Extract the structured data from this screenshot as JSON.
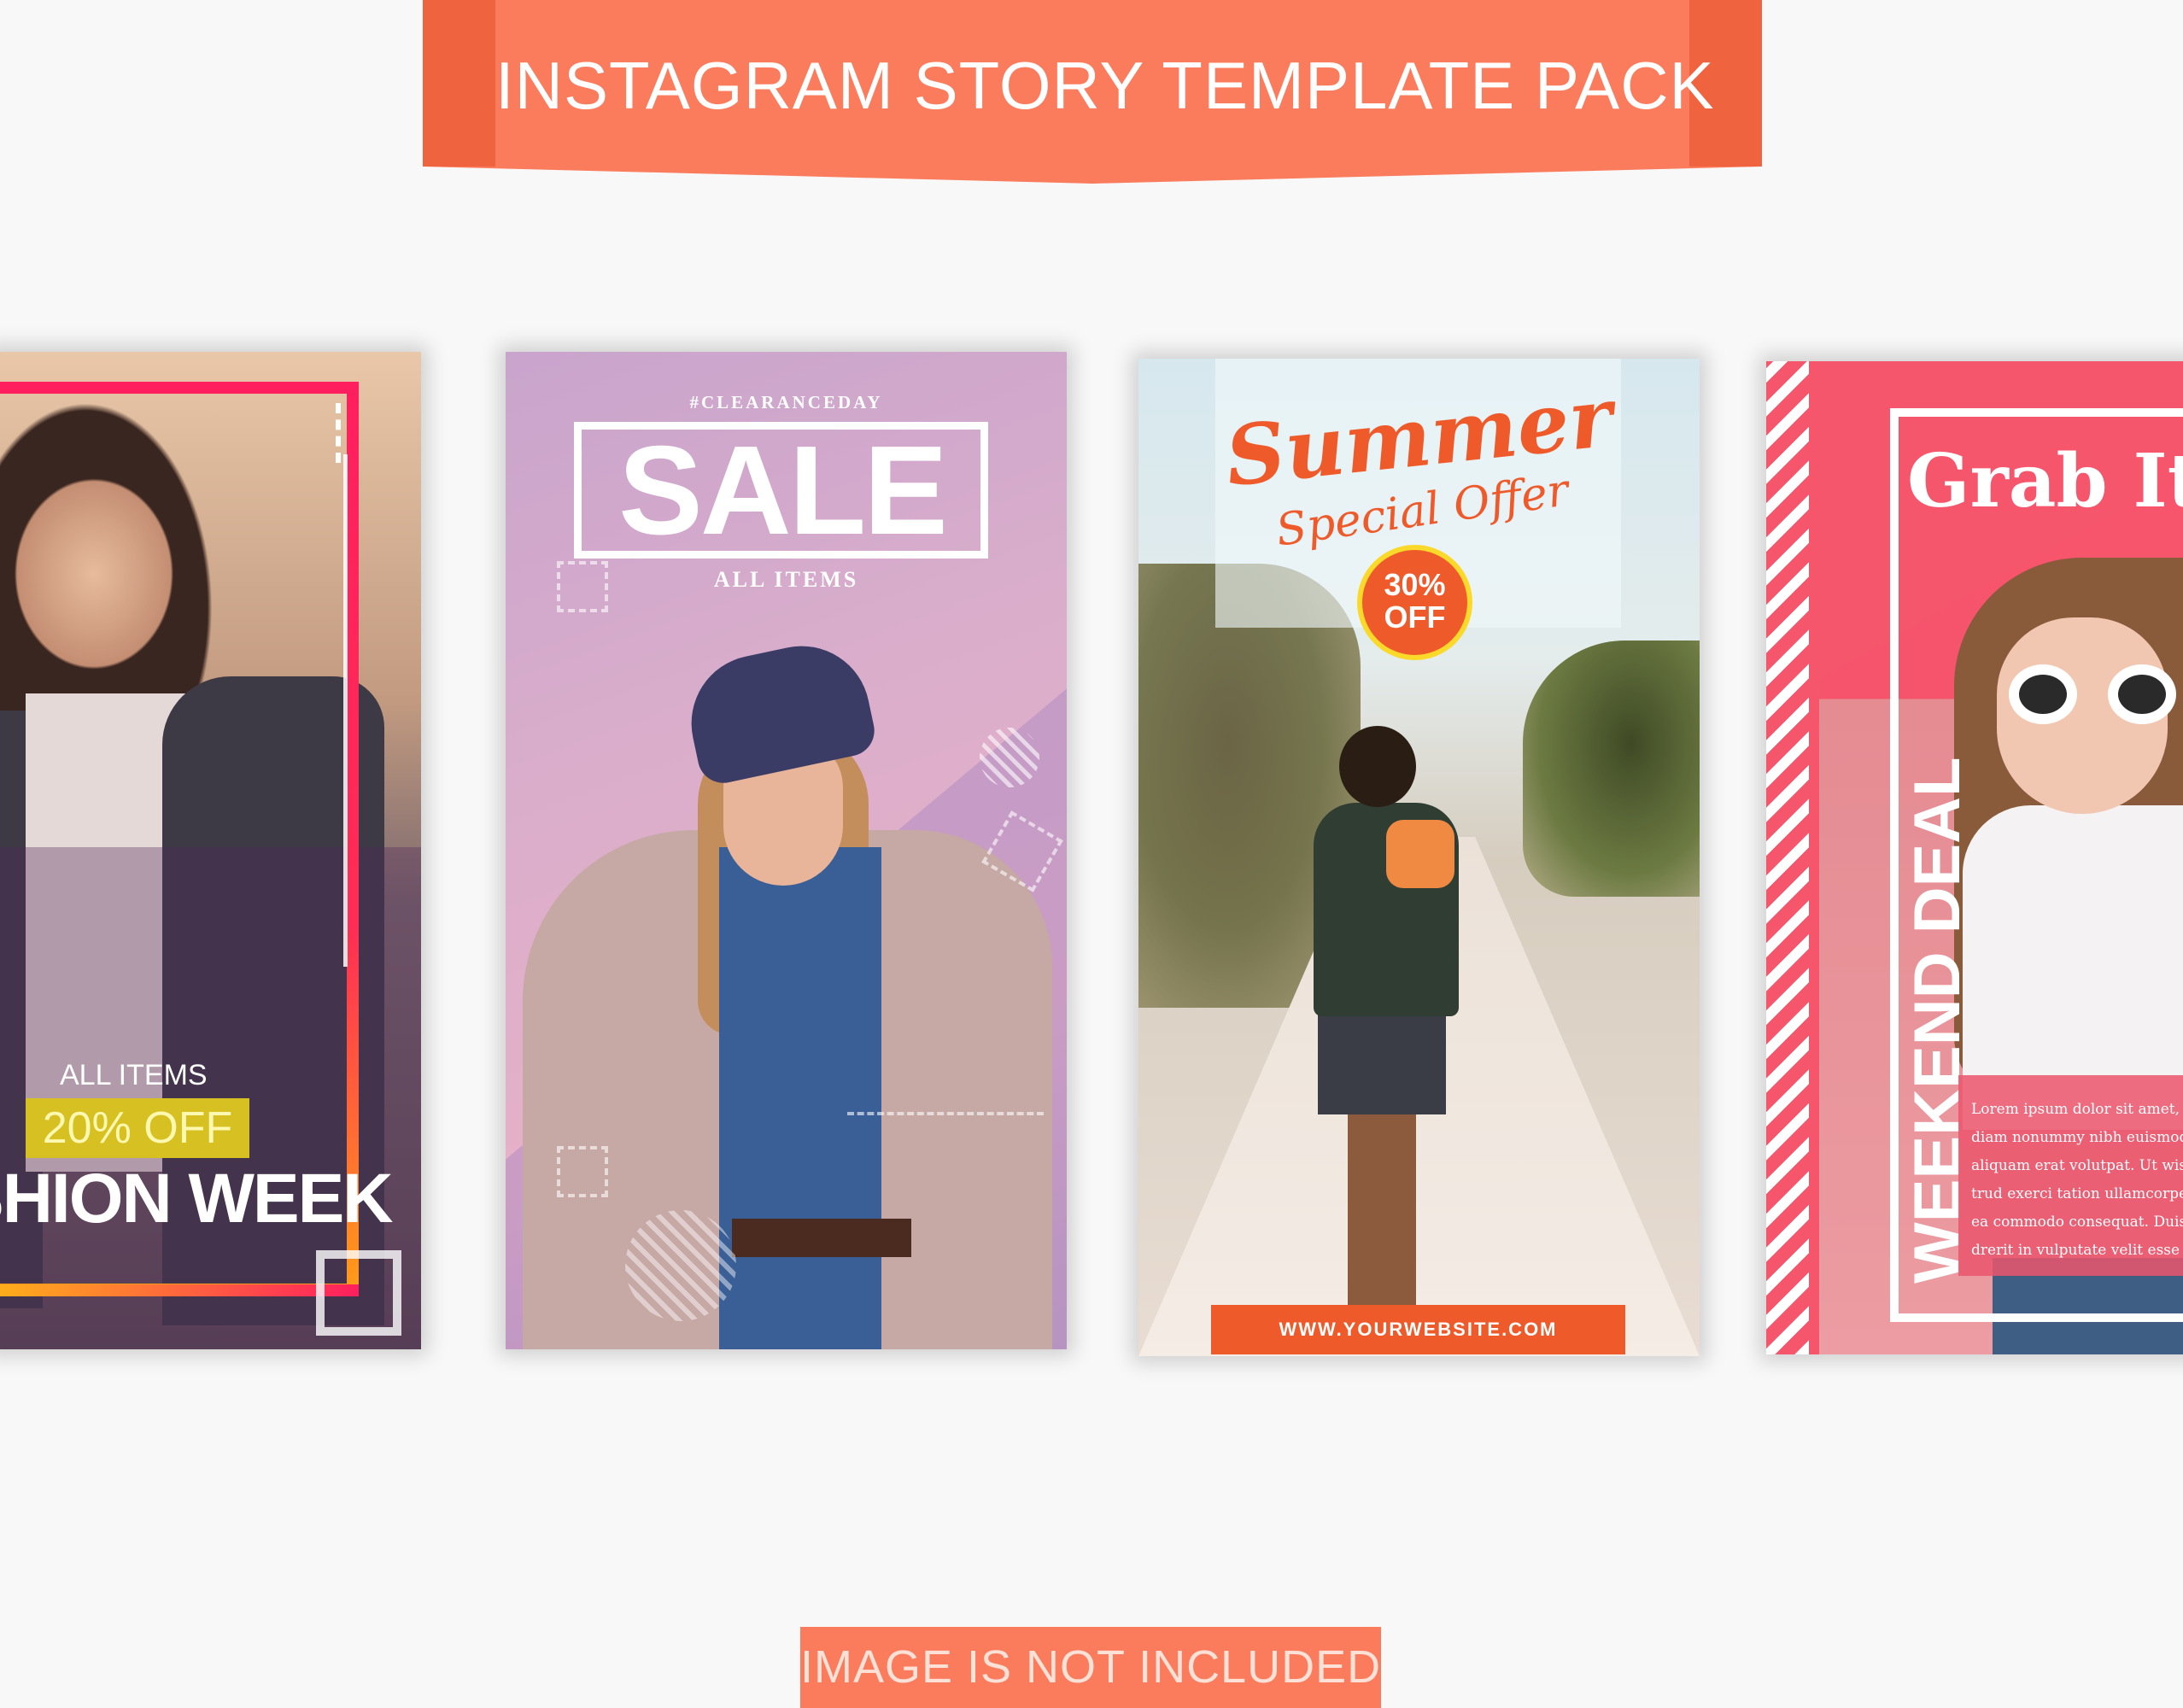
{
  "header": {
    "title": "INSTAGRAM STORY TEMPLATE PACK"
  },
  "footer": {
    "notice": "IMAGE IS NOT INCLUDED"
  },
  "cards": [
    {
      "label_small": "ALL ITEMS",
      "discount": "20% OFF",
      "headline": "SHION WEEK"
    },
    {
      "hashtag": "#CLEARANCEDAY",
      "headline": "SALE",
      "subline": "ALL ITEMS"
    },
    {
      "headline": "Summer",
      "subline": "Special Offer",
      "badge_line1": "30%",
      "badge_line2": "OFF",
      "url": "WWW.YOURWEBSITE.COM"
    },
    {
      "headline": "Grab It Fa",
      "vertical_text": "WEEKEND DEAL",
      "body_lines": [
        "Lorem ipsum dolor sit amet, consectetue",
        "diam nonummy nibh euismod tincidunt u",
        "aliquam erat volutpat. Ut wisi enim ad m",
        "trud exerci tation ullamcorper suscipit lo",
        "ea commodo consequat. Duis autem vel e",
        "drerit in vulputate velit esse molestie con"
      ]
    }
  ],
  "colors": {
    "accent": "#fb7c5d",
    "accent_dark": "#f0633f",
    "pink": "#f5566c",
    "orange": "#ef5a2a",
    "yellow": "#d7c021"
  }
}
